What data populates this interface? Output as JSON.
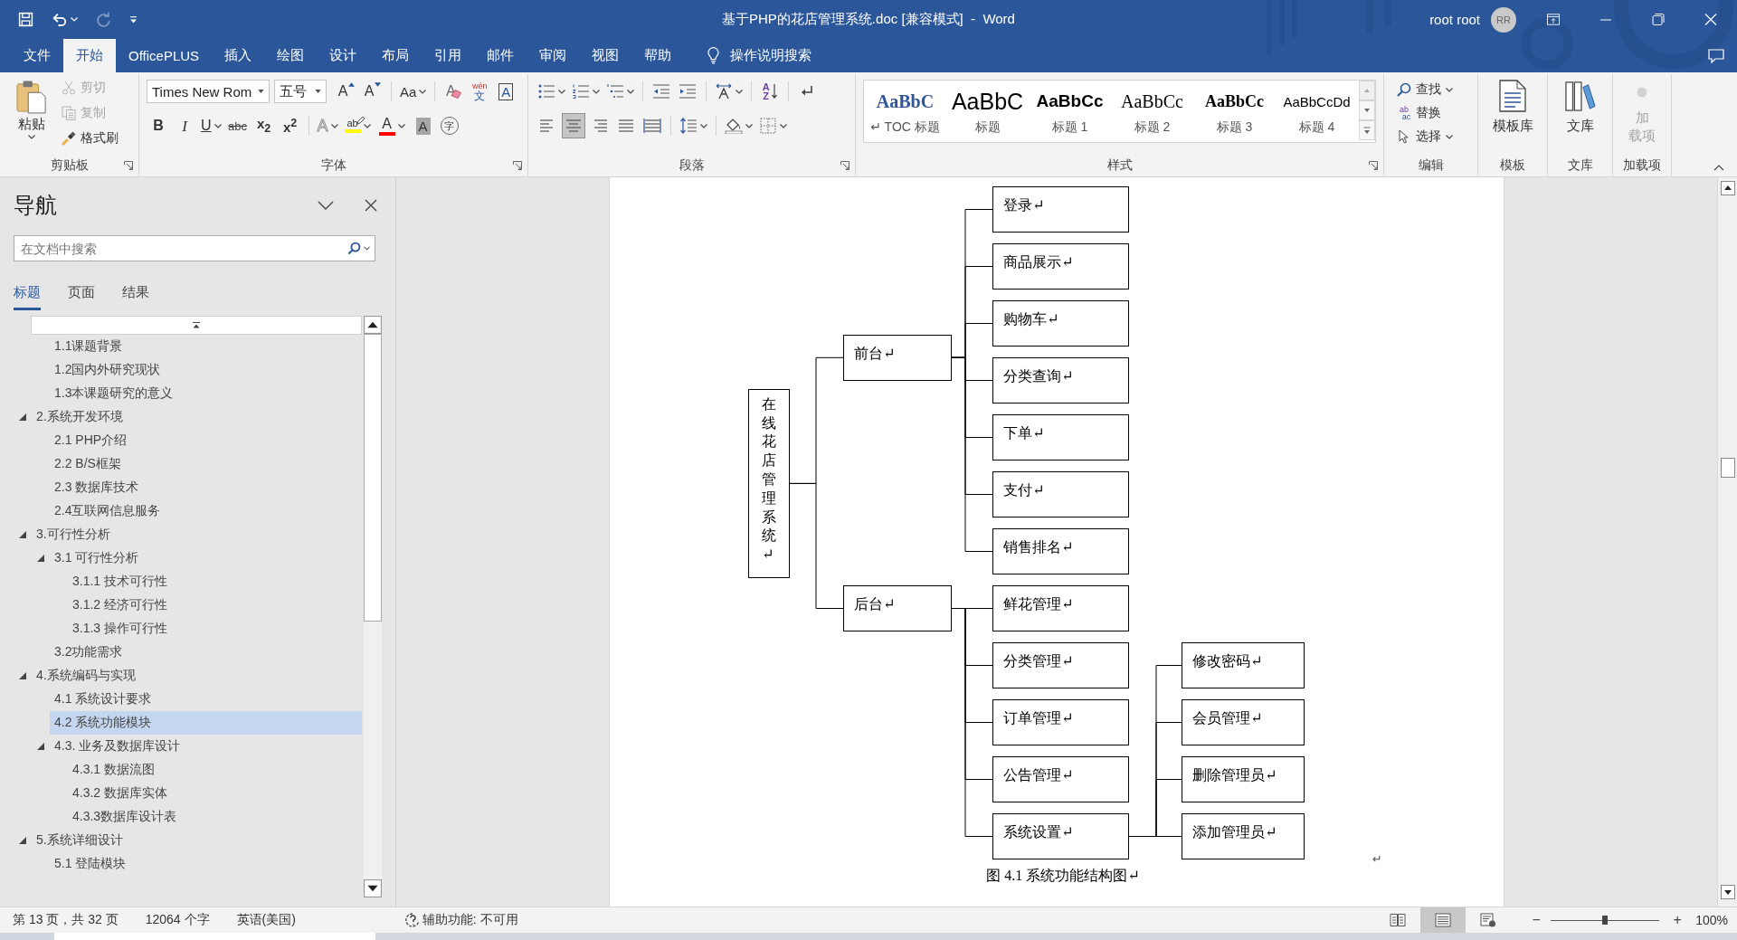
{
  "window": {
    "title": "基于PHP的花店管理系统.doc [兼容模式]  -  Word",
    "user": "root root",
    "avatar": "RR"
  },
  "quick_access": [
    {
      "kind": "save",
      "disabled": false
    },
    {
      "kind": "undo",
      "disabled": false
    },
    {
      "kind": "redo",
      "disabled": true
    },
    {
      "kind": "customize",
      "disabled": false
    }
  ],
  "menu": {
    "tabs": [
      {
        "label": "文件",
        "selected": false
      },
      {
        "label": "开始",
        "selected": true
      },
      {
        "label": "OfficePLUS",
        "selected": false
      },
      {
        "label": "插入",
        "selected": false
      },
      {
        "label": "绘图",
        "selected": false
      },
      {
        "label": "设计",
        "selected": false
      },
      {
        "label": "布局",
        "selected": false
      },
      {
        "label": "引用",
        "selected": false
      },
      {
        "label": "邮件",
        "selected": false
      },
      {
        "label": "审阅",
        "selected": false
      },
      {
        "label": "视图",
        "selected": false
      },
      {
        "label": "帮助",
        "selected": false
      }
    ],
    "tell_me": "操作说明搜索"
  },
  "ribbon": {
    "clipboard": {
      "label": "剪贴板",
      "paste": "粘贴",
      "tools": [
        {
          "kind": "cut",
          "label": "剪切",
          "disabled": true
        },
        {
          "kind": "copy",
          "label": "复制",
          "disabled": true
        },
        {
          "kind": "painter",
          "label": "格式刷",
          "disabled": false
        }
      ]
    },
    "font": {
      "label": "字体",
      "font_name": "Times New Rom",
      "font_size": "五号",
      "row1": [
        {
          "kind": "grow",
          "glyph": "A",
          "dropdown": false
        },
        {
          "kind": "shrink",
          "glyph": "A",
          "dropdown": false
        },
        {
          "kind": "case",
          "glyph": "Aa",
          "dropdown": true
        },
        {
          "kind": "clear",
          "glyph": "A",
          "dropdown": false
        },
        {
          "kind": "phonetic",
          "glyph": "wén",
          "base": "文",
          "dropdown": false
        },
        {
          "kind": "border",
          "glyph": "A",
          "dropdown": false
        }
      ],
      "row2": [
        {
          "kind": "bold",
          "glyph": "B",
          "dropdown": false
        },
        {
          "kind": "italic",
          "glyph": "I",
          "dropdown": false
        },
        {
          "kind": "underline",
          "glyph": "U",
          "dropdown": true
        },
        {
          "kind": "strike",
          "glyph": "abc",
          "dropdown": false
        },
        {
          "kind": "sub",
          "glyph": "x$_{2}$",
          "dropdown": false
        },
        {
          "kind": "sup",
          "glyph": "x$^{2}$",
          "dropdown": false
        },
        {
          "kind": "effects",
          "glyph": "A",
          "dropdown": true
        },
        {
          "kind": "highlight",
          "glyph": "ab",
          "color": "#ffff00",
          "dropdown": true
        },
        {
          "kind": "color",
          "glyph": "A",
          "color": "#ff0000",
          "dropdown": true
        },
        {
          "kind": "shading",
          "glyph": "A",
          "dropdown": false
        },
        {
          "kind": "enclose",
          "glyph": "字",
          "dropdown": false
        }
      ]
    },
    "paragraph": {
      "label": "段落",
      "row1": [
        {
          "kind": "bullets",
          "dropdown": true
        },
        {
          "kind": "numbering",
          "dropdown": true
        },
        {
          "kind": "multilevel",
          "dropdown": true
        },
        {
          "kind": "outdent",
          "dropdown": false
        },
        {
          "kind": "indent",
          "dropdown": false
        },
        {
          "kind": "asian",
          "dropdown": true
        },
        {
          "kind": "sort",
          "glyph": "AZ",
          "dropdown": false
        },
        {
          "kind": "marks",
          "dropdown": false
        }
      ],
      "alignment": [
        {
          "kind": "left",
          "selected": false
        },
        {
          "kind": "center",
          "selected": true
        },
        {
          "kind": "right",
          "selected": false
        },
        {
          "kind": "justify",
          "selected": false
        },
        {
          "kind": "distribute",
          "selected": false
        }
      ],
      "row2": [
        {
          "kind": "spacing",
          "dropdown": true
        },
        {
          "kind": "shading",
          "dropdown": true
        },
        {
          "kind": "borders",
          "dropdown": true
        }
      ]
    },
    "styles": {
      "label": "样式",
      "items": [
        {
          "kind": "toc",
          "preview": "AaBbC",
          "name": "↵ TOC 标题"
        },
        {
          "kind": "title",
          "preview": "AaBbC",
          "name": "标题"
        },
        {
          "kind": "h1",
          "preview": "AaBbCc",
          "name": "标题 1"
        },
        {
          "kind": "h2",
          "preview": "AaBbCc",
          "name": "标题 2"
        },
        {
          "kind": "h3",
          "preview": "AaBbCc",
          "name": "标题 3"
        },
        {
          "kind": "h4",
          "preview": "AaBbCcDd",
          "name": "标题 4"
        }
      ]
    },
    "editing": {
      "label": "编辑",
      "find": "查找",
      "replace": "替换",
      "replace_from": "ab",
      "replace_to": "ac",
      "select": "选择"
    },
    "template": {
      "label": "模板",
      "button": "模板库"
    },
    "library": {
      "label": "文库",
      "button": "文库"
    },
    "addins": {
      "label": "加载项",
      "button": "加载项",
      "disabled": true
    }
  },
  "nav": {
    "title": "导航",
    "search": {
      "placeholder": "在文档中搜索"
    },
    "tabs": [
      {
        "label": "标题",
        "selected": true
      },
      {
        "label": "页面",
        "selected": false
      },
      {
        "label": "结果",
        "selected": false
      }
    ],
    "headings": [
      {
        "children": [
          {
            "label": "1.1课题背景",
            "selected": false
          },
          {
            "label": "1.2国内外研究现状",
            "selected": false
          },
          {
            "label": "1.3本课题研究的意义",
            "selected": false
          }
        ]
      },
      {
        "label": "2.系统开发环境",
        "expanded": true,
        "selected": false,
        "children": [
          {
            "label": "2.1 PHP介绍",
            "selected": false
          },
          {
            "label": "2.2 B/S框架",
            "selected": false
          },
          {
            "label": "2.3 数据库技术",
            "selected": false
          },
          {
            "label": "2.4互联网信息服务",
            "selected": false
          }
        ]
      },
      {
        "label": "3.可行性分析",
        "expanded": true,
        "selected": false,
        "children": [
          {
            "label": "3.1 可行性分析",
            "expanded": true,
            "selected": false,
            "children": [
              {
                "label": "3.1.1 技术可行性",
                "selected": false
              },
              {
                "label": "3.1.2 经济可行性",
                "selected": false
              },
              {
                "label": "3.1.3 操作可行性",
                "selected": false
              }
            ]
          },
          {
            "label": "3.2功能需求",
            "selected": false
          }
        ]
      },
      {
        "label": "4.系统编码与实现",
        "expanded": true,
        "selected": false,
        "children": [
          {
            "label": "4.1 系统设计要求",
            "selected": false
          },
          {
            "label": "4.2 系统功能模块",
            "selected": true
          },
          {
            "label": "4.3. 业务及数据库设计",
            "expanded": true,
            "selected": false,
            "children": [
              {
                "label": "4.3.1 数据流图",
                "selected": false
              },
              {
                "label": "4.3.2 数据库实体",
                "selected": false
              },
              {
                "label": "4.3.3数据库设计表",
                "selected": false
              }
            ]
          }
        ]
      },
      {
        "label": "5.系统详细设计",
        "expanded": true,
        "selected": false,
        "children": [
          {
            "label": "5.1 登陆模块",
            "selected": false
          }
        ]
      }
    ]
  },
  "document": {
    "diagram": {
      "root": {
        "label": "在线花店管理系统↵",
        "children": [
          {
            "label": "前台↵",
            "children": [
              {
                "label": "登录↵"
              },
              {
                "label": "商品展示↵"
              },
              {
                "label": "购物车↵"
              },
              {
                "label": "分类查询↵"
              },
              {
                "label": "下单↵"
              },
              {
                "label": "支付↵"
              },
              {
                "label": "销售排名↵"
              }
            ]
          },
          {
            "label": "后台↵",
            "children": [
              {
                "label": "鲜花管理↵"
              },
              {
                "label": "分类管理↵"
              },
              {
                "label": "订单管理↵"
              },
              {
                "label": "公告管理↵"
              },
              {
                "label": "系统设置↵",
                "children": [
                  {
                    "label": "修改密码↵"
                  },
                  {
                    "label": "会员管理↵"
                  },
                  {
                    "label": "删除管理员↵"
                  },
                  {
                    "label": "添加管理员↵"
                  }
                ]
              }
            ]
          }
        ]
      }
    },
    "paragraph_mark": "↵",
    "caption": "图 4.1 系统功能结构图↵"
  },
  "status_bar": {
    "page": "第 13 页，共 32 页",
    "words": "12064 个字",
    "language": "英语(美国)",
    "accessibility": "辅助功能: 不可用",
    "views": [
      {
        "kind": "read",
        "selected": false
      },
      {
        "kind": "print",
        "selected": true
      },
      {
        "kind": "web",
        "selected": false
      }
    ],
    "zoom": {
      "minus": "−",
      "plus": "+",
      "level": 0.5,
      "percent": "100%"
    }
  }
}
